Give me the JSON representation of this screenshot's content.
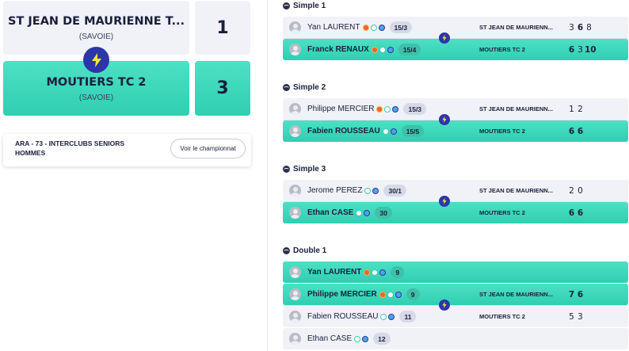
{
  "encounter": {
    "home": {
      "name": "ST JEAN DE MAURIENNE T...",
      "region": "(SAVOIE)",
      "score": "1"
    },
    "away": {
      "name": "MOUTIERS TC 2",
      "region": "(SAVOIE)",
      "score": "3"
    },
    "vs_icon": "lightning-icon"
  },
  "championship": {
    "title": "ARA - 73 - INTERCLUBS SENIORS HOMMES",
    "button_label": "Voir le championnat"
  },
  "colors": {
    "winner": "#2fcfb2",
    "neutral": "#f1f2f8",
    "accent": "#2d36a8",
    "text": "#1a1f3c"
  },
  "matches": [
    {
      "title": "Simple 1",
      "rows": [
        {
          "player": "Yan LAURENT",
          "rank": "15/3",
          "icons": [
            "fire",
            "round",
            "target"
          ],
          "win": false
        },
        {
          "player": "Franck RENAUX",
          "rank": "15/4",
          "icons": [
            "fire",
            "round",
            "target"
          ],
          "win": true
        }
      ],
      "home_club": "ST JEAN DE MAURIENN...",
      "away_club": "MOUTIERS TC 2",
      "home_sets": [
        "3",
        "6",
        "8"
      ],
      "away_sets": [
        "6",
        "3",
        "10"
      ],
      "home_set_wins": [
        false,
        true,
        false
      ],
      "away_set_wins": [
        true,
        false,
        true
      ]
    },
    {
      "title": "Simple 2",
      "rows": [
        {
          "player": "Philippe MERCIER",
          "rank": "15/3",
          "icons": [
            "fire",
            "round",
            "target"
          ],
          "win": false
        },
        {
          "player": "Fabien ROUSSEAU",
          "rank": "15/5",
          "icons": [
            "round",
            "target"
          ],
          "win": true
        }
      ],
      "home_club": "ST JEAN DE MAURIENN...",
      "away_club": "MOUTIERS TC 2",
      "home_sets": [
        "1",
        "2"
      ],
      "away_sets": [
        "6",
        "6"
      ],
      "home_set_wins": [
        false,
        false
      ],
      "away_set_wins": [
        true,
        true
      ]
    },
    {
      "title": "Simple 3",
      "rows": [
        {
          "player": "Jerome PEREZ",
          "rank": "30/1",
          "icons": [
            "round",
            "target"
          ],
          "win": false
        },
        {
          "player": "Ethan CASE",
          "rank": "30",
          "icons": [
            "round",
            "target"
          ],
          "win": true
        }
      ],
      "home_club": "ST JEAN DE MAURIENN...",
      "away_club": "MOUTIERS TC 2",
      "home_sets": [
        "2",
        "0"
      ],
      "away_sets": [
        "6",
        "6"
      ],
      "home_set_wins": [
        false,
        false
      ],
      "away_set_wins": [
        true,
        true
      ]
    },
    {
      "title": "Double 1",
      "rows": [
        {
          "player": "Yan LAURENT",
          "rank": "9",
          "icons": [
            "fire",
            "round",
            "target"
          ],
          "win": true
        },
        {
          "player": "Philippe MERCIER",
          "rank": "9",
          "icons": [
            "fire",
            "round",
            "target"
          ],
          "win": true
        },
        {
          "player": "Fabien ROUSSEAU",
          "rank": "11",
          "icons": [
            "round",
            "target"
          ],
          "win": false
        },
        {
          "player": "Ethan CASE",
          "rank": "12",
          "icons": [
            "round",
            "target"
          ],
          "win": false
        }
      ],
      "home_club": "ST JEAN DE MAURIENN...",
      "away_club": "MOUTIERS TC 2",
      "home_sets": [
        "7",
        "6"
      ],
      "away_sets": [
        "5",
        "3"
      ],
      "home_set_wins": [
        true,
        true
      ],
      "away_set_wins": [
        false,
        false
      ]
    }
  ]
}
